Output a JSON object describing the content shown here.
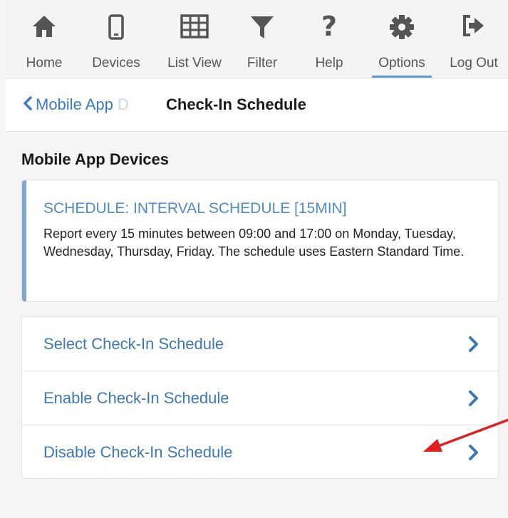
{
  "toolbar": {
    "items": [
      {
        "label": "Home",
        "icon": "home-icon"
      },
      {
        "label": "Devices",
        "icon": "phone-icon"
      },
      {
        "label": "List View",
        "icon": "grid-icon"
      },
      {
        "label": "Filter",
        "icon": "filter-icon"
      },
      {
        "label": "Help",
        "icon": "question-icon"
      },
      {
        "label": "Options",
        "icon": "gear-icon",
        "active": true
      },
      {
        "label": "Log Out",
        "icon": "logout-icon"
      }
    ]
  },
  "header": {
    "back_label": "Mobile App",
    "back_fade": "D",
    "title": "Check-In Schedule"
  },
  "section": {
    "title": "Mobile App Devices"
  },
  "schedule_card": {
    "title": "SCHEDULE: INTERVAL SCHEDULE [15MIN]",
    "body": "Report every 15 minutes between 09:00 and 17:00 on Monday, Tuesday, Wednesday, Thursday, Friday. The schedule uses Eastern Standard Time."
  },
  "actions": [
    {
      "label": "Select Check-In Schedule"
    },
    {
      "label": "Enable Check-In Schedule"
    },
    {
      "label": "Disable Check-In Schedule"
    }
  ],
  "colors": {
    "accent": "#3c78b6",
    "card_bar": "#7ba7d0",
    "annotation_arrow": "#e02020",
    "icon_gray": "#555555"
  }
}
